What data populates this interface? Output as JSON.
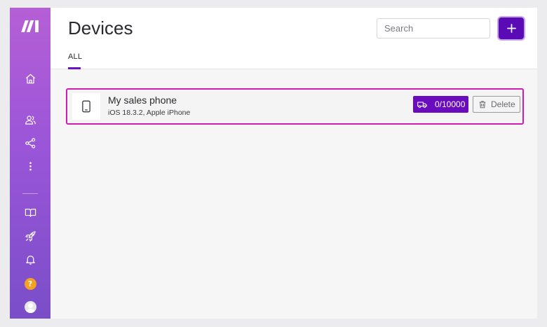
{
  "header": {
    "title": "Devices",
    "search_placeholder": "Search",
    "add_button_label": "+"
  },
  "tabs": [
    {
      "label": "ALL",
      "active": true
    }
  ],
  "devices": [
    {
      "name": "My sales phone",
      "details": "iOS 18.3.2, Apple iPhone",
      "quota": "0/10000",
      "delete_label": "Delete"
    }
  ],
  "sidebar": {
    "logo_icon": "make-logo-icon",
    "items": [
      {
        "icon": "home-icon"
      },
      {
        "icon": "users-icon"
      },
      {
        "icon": "share-icon"
      },
      {
        "icon": "more-vertical-icon"
      },
      {
        "icon": "book-icon"
      },
      {
        "icon": "rocket-icon"
      },
      {
        "icon": "bell-icon"
      },
      {
        "icon": "help-icon",
        "label": "?"
      },
      {
        "icon": "avatar-icon"
      }
    ]
  },
  "colors": {
    "accent": "#5b0bb5",
    "badge": "#6a0bbd",
    "card_border": "#d11bb2",
    "help": "#f4a21f"
  }
}
